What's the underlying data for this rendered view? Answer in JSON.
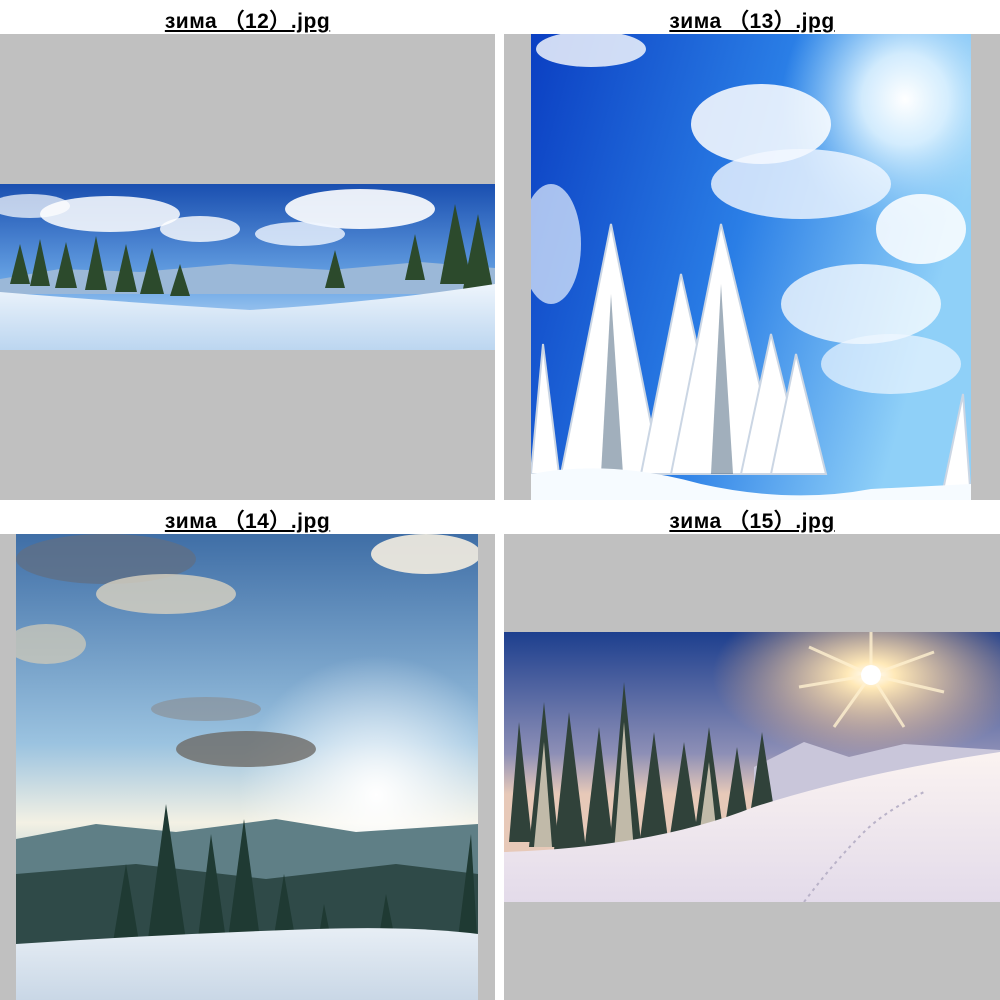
{
  "thumbnails": [
    {
      "id": "12",
      "caption": "зима （12）.jpg",
      "orientation": "panorama"
    },
    {
      "id": "13",
      "caption": "зима （13）.jpg",
      "orientation": "portrait"
    },
    {
      "id": "14",
      "caption": "зима （14）.jpg",
      "orientation": "portrait"
    },
    {
      "id": "15",
      "caption": "зима （15）.jpg",
      "orientation": "landscape"
    }
  ],
  "colors": {
    "frame_background": "#c0c0c0",
    "page_background": "#ffffff",
    "caption_text": "#000000"
  }
}
